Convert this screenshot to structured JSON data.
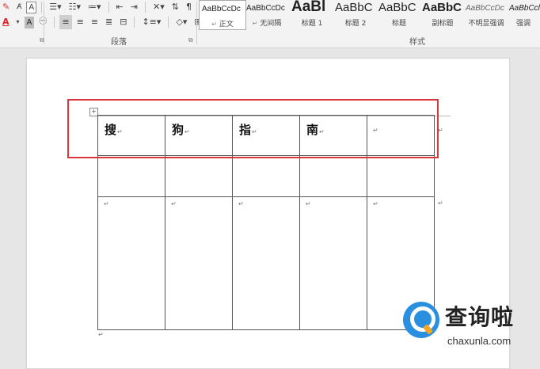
{
  "ribbon": {
    "font_color_label": "A",
    "char_shade_label": "A",
    "font_border_label": "A",
    "paragraph_group_label": "段落",
    "styles_group_label": "样式",
    "styles": [
      {
        "preview": "AaBbCcDc",
        "name": "正文",
        "paragraph_mark": "↵"
      },
      {
        "preview": "AaBbCcDc",
        "name": "无间隔",
        "paragraph_mark": "↵"
      },
      {
        "preview": "AaBl",
        "name": "标题 1"
      },
      {
        "preview": "AaBbC",
        "name": "标题 2"
      },
      {
        "preview": "AaBbC",
        "name": "标题"
      },
      {
        "preview": "AaBbC",
        "name": "副标题"
      },
      {
        "preview": "AaBbCcDc",
        "name": "不明显强调"
      },
      {
        "preview": "AaBbCcl",
        "name": "强调"
      }
    ]
  },
  "document": {
    "table_handle": "+",
    "paragraph_mark": "↵",
    "header_row": [
      "搜",
      "狗",
      "指",
      "南",
      ""
    ]
  },
  "watermark": {
    "title": "查询啦",
    "url": "chaxunla.com"
  },
  "colors": {
    "highlight": "#d9363e",
    "font_color_red": "#e02020",
    "logo_blue": "#2b8fe0",
    "logo_orange": "#f6a623"
  }
}
